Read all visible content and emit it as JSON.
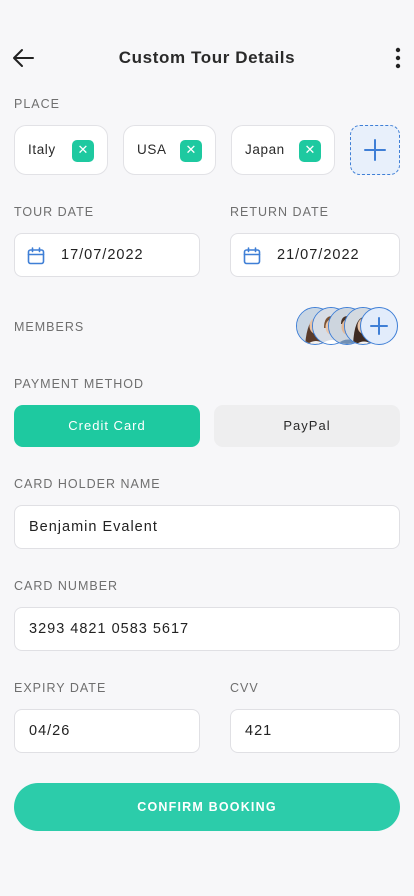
{
  "header": {
    "title": "Custom Tour Details"
  },
  "place": {
    "label": "PLACE",
    "items": [
      {
        "name": "Italy",
        "remove": "✕"
      },
      {
        "name": "USA",
        "remove": "✕"
      },
      {
        "name": "Japan",
        "remove": "✕"
      }
    ]
  },
  "tour_date": {
    "label": "TOUR DATE",
    "value": "17/07/2022"
  },
  "return_date": {
    "label": "RETURN DATE",
    "value": "21/07/2022"
  },
  "members": {
    "label": "MEMBERS"
  },
  "payment": {
    "label": "PAYMENT METHOD",
    "credit_card": "Credit Card",
    "paypal": "PayPal",
    "selected": "Credit Card"
  },
  "card_holder": {
    "label": "CARD HOLDER NAME",
    "value": "Benjamin Evalent"
  },
  "card_number": {
    "label": "CARD NUMBER",
    "value": "3293 4821 0583 5617"
  },
  "expiry": {
    "label": "EXPIRY DATE",
    "value": "04/26"
  },
  "cvv": {
    "label": "CVV",
    "value": "421"
  },
  "confirm": {
    "label": "CONFIRM BOOKING"
  },
  "colors": {
    "accent": "#1ec9a0",
    "blue": "#3f7fd6",
    "background": "#f7f7f9"
  },
  "icons": {
    "back": "arrow-left-icon",
    "menu": "more-vertical-icon",
    "calendar": "calendar-icon",
    "add": "plus-icon",
    "remove": "close-icon"
  }
}
